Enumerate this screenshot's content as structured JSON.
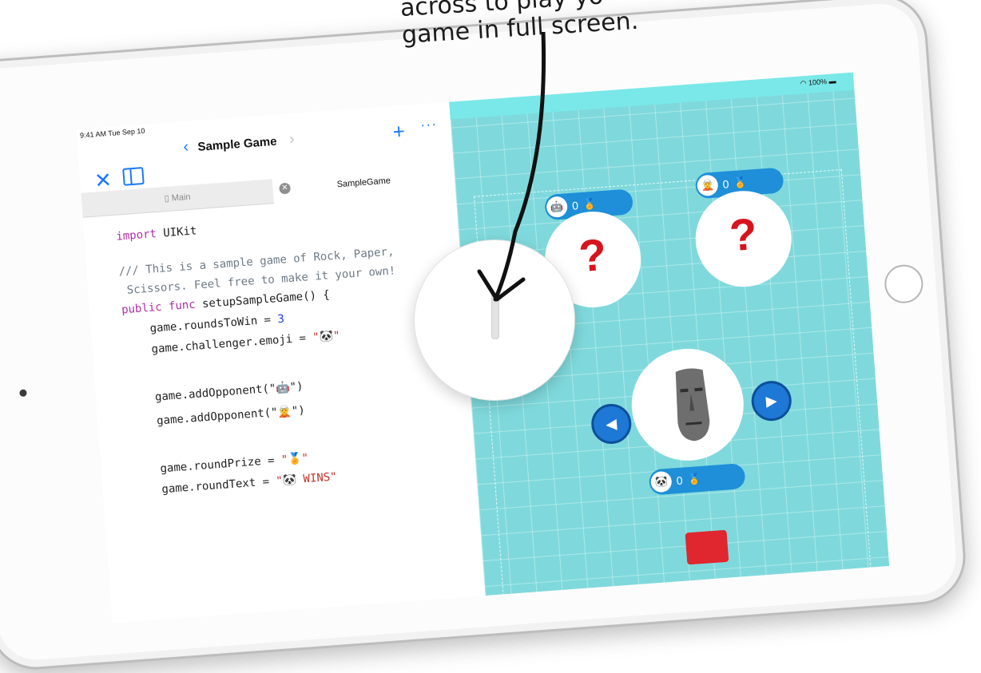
{
  "caption": {
    "line1": "across to play yo",
    "line2": "game in full screen."
  },
  "status_bar": {
    "time": "9:41 AM  Tue Sep 10",
    "battery": "100%"
  },
  "nav": {
    "title": "Sample Game",
    "back_glyph": "‹",
    "forward_glyph": "›",
    "add_glyph": "+",
    "more_glyph": "···",
    "close_glyph": "✕"
  },
  "tabs": {
    "main_label": "Main",
    "sample_label": "SampleGame",
    "close_glyph": "✕"
  },
  "code": {
    "l1_kw": "import",
    "l1_rest": " UIKit",
    "l2": "/// This is a sample game of Rock, Paper,",
    "l3": " Scissors. Feel free to make it your own!",
    "l4_kw": "public func",
    "l4_rest": " setupSampleGame() {",
    "l5_pre": "    game.roundsToWin = ",
    "l5_num": "3",
    "l6_pre": "    game.challenger.emoji = ",
    "l6_str": "\"🐼\"",
    "l7": "    game.addOpponent(\"🤖\")",
    "l8": "    game.addOpponent(\"🧝\")",
    "l9_pre": "    game.roundPrize = ",
    "l9_str": "\"🏅\"",
    "l10_pre": "    game.roundText = ",
    "l10_str": "\"🐼 WINS\""
  },
  "game": {
    "opponent1": {
      "avatar": "🤖",
      "score": "0",
      "medal": "🏅"
    },
    "opponent2": {
      "avatar": "🧝",
      "score": "0",
      "medal": "🏅"
    },
    "challenger": {
      "avatar": "🐼",
      "score": "0",
      "medal": "🏅"
    },
    "question_mark": "?",
    "left_arrow": "◀",
    "right_arrow": "▶"
  },
  "colors": {
    "accent": "#1a78ff",
    "game_background": "#7fd9dc",
    "question": "#d7141d",
    "pill": "#1e8fd8"
  }
}
